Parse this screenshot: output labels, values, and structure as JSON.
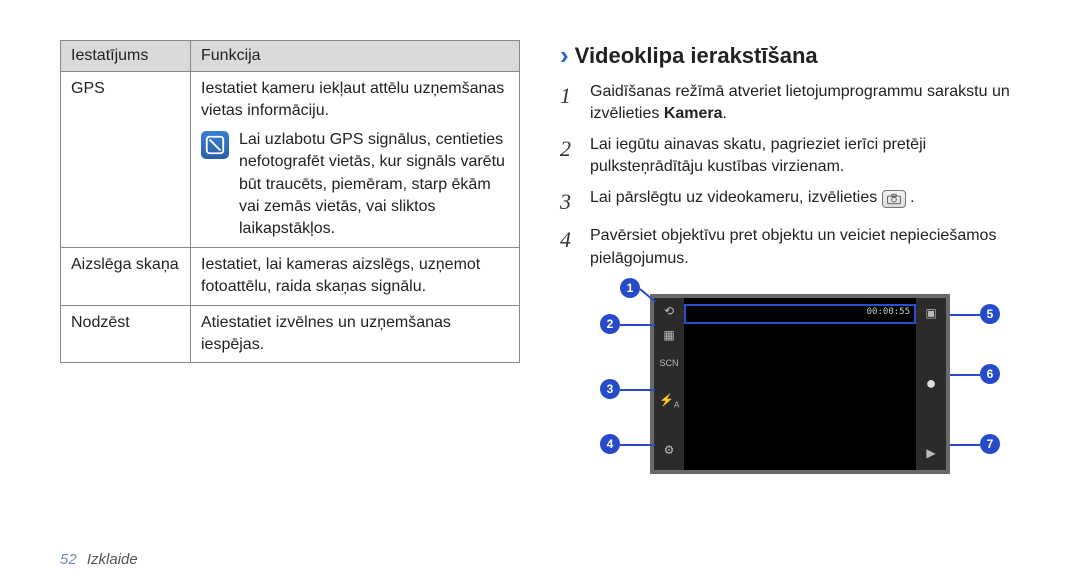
{
  "table": {
    "headers": {
      "col1": "Iestatījums",
      "col2": "Funkcija"
    },
    "rows": [
      {
        "name": "GPS",
        "desc": "Iestatiet kameru iekļaut attēlu uzņemšanas vietas informāciju.",
        "note": "Lai uzlabotu GPS signālus, centieties nefotografēt vietās, kur signāls varētu būt traucēts, piemēram, starp ēkām vai zemās vietās, vai sliktos laikapstākļos."
      },
      {
        "name": "Aizslēga skaņa",
        "desc": "Iestatiet, lai kameras aizslēgs, uzņemot fotoattēlu, raida skaņas signālu."
      },
      {
        "name": "Nodzēst",
        "desc": "Atiestatiet izvēlnes un uzņemšanas iespējas."
      }
    ]
  },
  "heading": "Videoklipa ierakstīšana",
  "steps": [
    {
      "n": "1",
      "pre": "Gaidīšanas režīmā atveriet lietojumprogrammu sarakstu un izvēlieties ",
      "bold": "Kamera",
      "post": "."
    },
    {
      "n": "2",
      "text": "Lai iegūtu ainavas skatu, pagrieziet ierīci pretēji pulksteņrādītāju kustības virzienam."
    },
    {
      "n": "3",
      "pre": "Lai pārslēgtu uz videokameru, izvēlieties ",
      "icon": true,
      "post": "."
    },
    {
      "n": "4",
      "text": "Pavērsiet objektīvu pret objektu un veiciet nepieciešamos pielāgojumus."
    }
  ],
  "diagram": {
    "time": "00:00:55",
    "callouts": [
      "1",
      "2",
      "3",
      "4",
      "5",
      "6",
      "7"
    ]
  },
  "footer": {
    "page": "52",
    "section": "Izklaide"
  }
}
